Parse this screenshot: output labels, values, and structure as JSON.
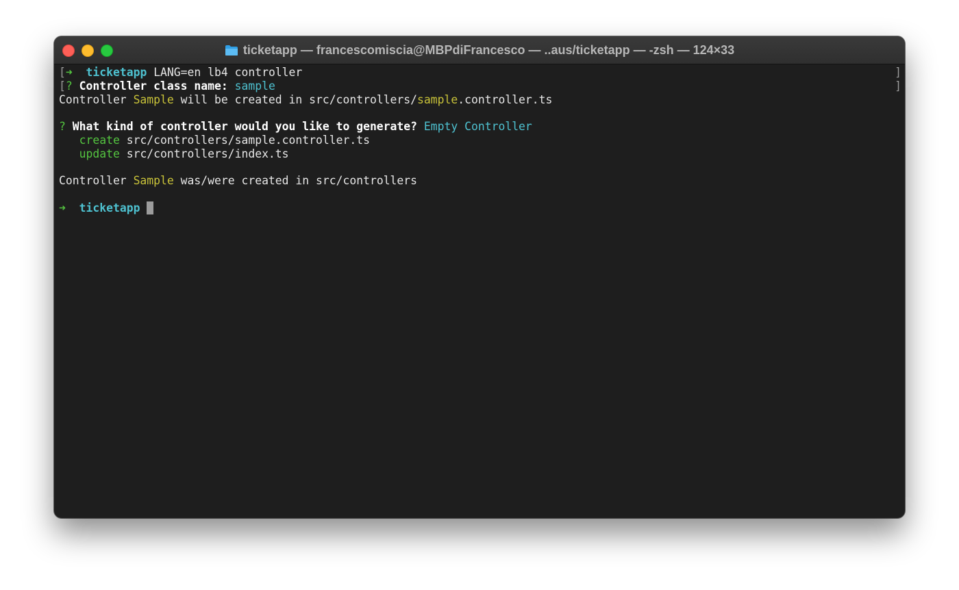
{
  "window": {
    "title": "ticketapp — francescomiscia@MBPdiFrancesco — ..aus/ticketapp — -zsh — 124×33",
    "title_icon": "folder-icon",
    "traffic_lights": {
      "close": "#fe5f57",
      "minimize": "#febc2e",
      "zoom": "#28c840"
    }
  },
  "colors": {
    "background": "#1e1e1e",
    "prompt_arrow": "#54c440",
    "directory": "#4ec1d0",
    "highlight": "#c9c339",
    "action": "#54c440"
  },
  "terminal": {
    "line1": {
      "open_bracket": "[",
      "arrow": "➜",
      "dir": "ticketapp",
      "command": "LANG=en lb4 controller",
      "close_bracket": "]"
    },
    "line2": {
      "open_bracket": "[",
      "mark": "?",
      "question": "Controller class name:",
      "answer": "sample",
      "close_bracket": "]"
    },
    "line3": {
      "p1": "Controller ",
      "name": "Sample",
      "p2": " will be created in src/controllers/",
      "file_name": "sample",
      "p3": ".controller.ts"
    },
    "line5": {
      "mark": "?",
      "question": "What kind of controller would you like to generate?",
      "answer": "Empty Controller"
    },
    "line6": {
      "action": "create",
      "path": "src/controllers/sample.controller.ts"
    },
    "line7": {
      "action": "update",
      "path": "src/controllers/index.ts"
    },
    "line9": {
      "p1": "Controller ",
      "name": "Sample",
      "p2": " was/were created in src/controllers"
    },
    "line11": {
      "arrow": "➜",
      "dir": "ticketapp"
    }
  }
}
